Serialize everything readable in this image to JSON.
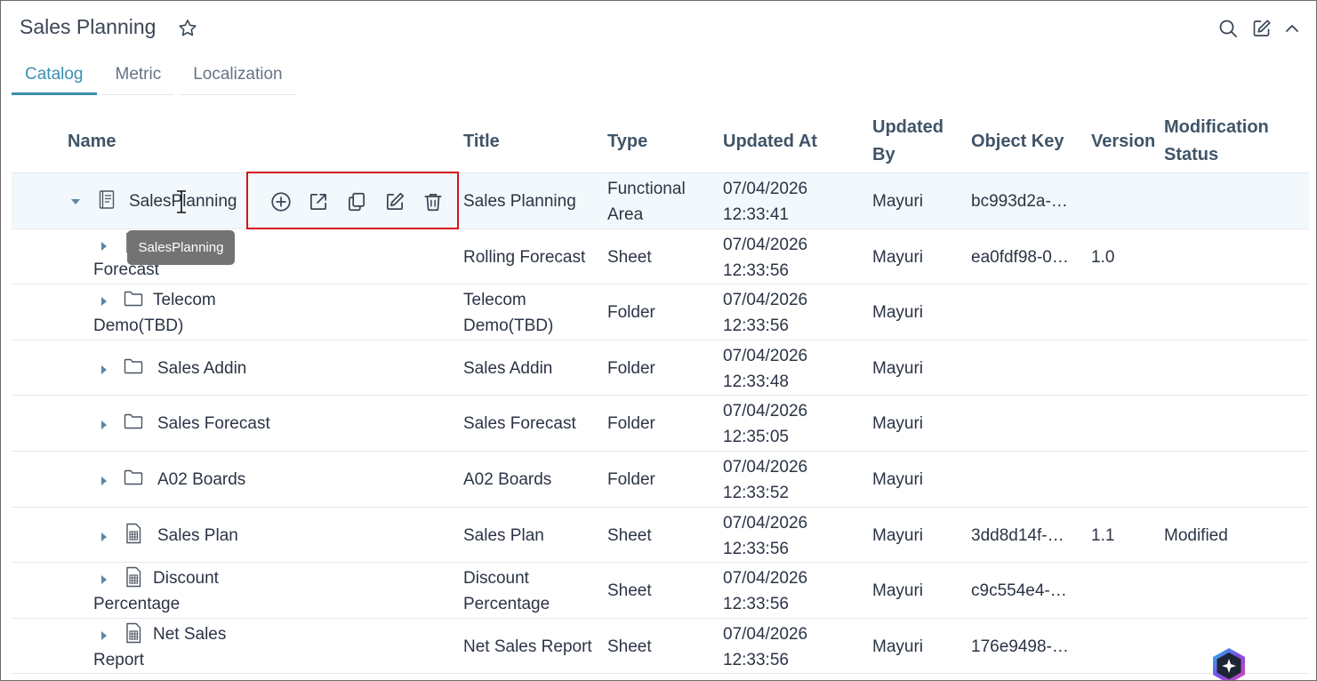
{
  "header": {
    "title": "Sales Planning",
    "icons": [
      "star-icon",
      "search-icon",
      "edit-icon",
      "chevron-up-icon"
    ]
  },
  "tabs": [
    {
      "label": "Catalog",
      "active": true
    },
    {
      "label": "Metric",
      "active": false
    },
    {
      "label": "Localization",
      "active": false
    }
  ],
  "columns": {
    "name": "Name",
    "title": "Title",
    "type": "Type",
    "updated_at": "Updated At",
    "updated_by_1": "Updated",
    "updated_by_2": "By",
    "object_key": "Object Key",
    "version": "Version",
    "mod_status_1": "Modification",
    "mod_status_2": "Status"
  },
  "rows": [
    {
      "name1": "SalesPlanning",
      "name2": "",
      "title1": "Sales Planning",
      "title2": "",
      "type1": "Functional",
      "type2": "Area",
      "date": "07/04/2026",
      "time": "12:33:41",
      "by": "Mayuri",
      "key": "bc993d2a-…",
      "version": "",
      "status": "",
      "icon": "functional-area-icon",
      "expanded": true
    },
    {
      "name1": "",
      "name2": "Forecast",
      "title1": "Rolling Forecast",
      "title2": "",
      "type1": "Sheet",
      "type2": "",
      "date": "07/04/2026",
      "time": "12:33:56",
      "by": "Mayuri",
      "key": "ea0fdf98-0…",
      "version": "1.0",
      "status": "",
      "icon": "sheet-icon"
    },
    {
      "name1": "Telecom",
      "name2": "Demo(TBD)",
      "title1": "Telecom",
      "title2": "Demo(TBD)",
      "type1": "Folder",
      "type2": "",
      "date": "07/04/2026",
      "time": "12:33:56",
      "by": "Mayuri",
      "key": "",
      "version": "",
      "status": "",
      "icon": "folder-icon"
    },
    {
      "name1": "Sales Addin",
      "name2": "",
      "title1": "Sales Addin",
      "title2": "",
      "type1": "Folder",
      "type2": "",
      "date": "07/04/2026",
      "time": "12:33:48",
      "by": "Mayuri",
      "key": "",
      "version": "",
      "status": "",
      "icon": "folder-icon"
    },
    {
      "name1": "Sales Forecast",
      "name2": "",
      "title1": "Sales Forecast",
      "title2": "",
      "type1": "Folder",
      "type2": "",
      "date": "07/04/2026",
      "time": "12:35:05",
      "by": "Mayuri",
      "key": "",
      "version": "",
      "status": "",
      "icon": "folder-icon"
    },
    {
      "name1": "A02 Boards",
      "name2": "",
      "title1": "A02 Boards",
      "title2": "",
      "type1": "Folder",
      "type2": "",
      "date": "07/04/2026",
      "time": "12:33:52",
      "by": "Mayuri",
      "key": "",
      "version": "",
      "status": "",
      "icon": "folder-icon"
    },
    {
      "name1": "Sales Plan",
      "name2": "",
      "title1": "Sales Plan",
      "title2": "",
      "type1": "Sheet",
      "type2": "",
      "date": "07/04/2026",
      "time": "12:33:56",
      "by": "Mayuri",
      "key": "3dd8d14f-…",
      "version": "1.1",
      "status": "Modified",
      "icon": "sheet-icon"
    },
    {
      "name1": "Discount",
      "name2": "Percentage",
      "title1": "Discount",
      "title2": "Percentage",
      "type1": "Sheet",
      "type2": "",
      "date": "07/04/2026",
      "time": "12:33:56",
      "by": "Mayuri",
      "key": "c9c554e4-…",
      "version": "",
      "status": "",
      "icon": "sheet-icon"
    },
    {
      "name1": "Net Sales",
      "name2": "Report",
      "title1": "Net Sales Report",
      "title2": "",
      "type1": "Sheet",
      "type2": "",
      "date": "07/04/2026",
      "time": "12:33:56",
      "by": "Mayuri",
      "key": "176e9498-…",
      "version": "",
      "status": "",
      "icon": "sheet-icon"
    }
  ],
  "row_actions": [
    "add-icon",
    "open-external-icon",
    "copy-icon",
    "edit-icon",
    "delete-icon"
  ],
  "tooltip": "SalesPlanning",
  "colors": {
    "accent": "#3c8fb0",
    "highlight": "#d6141a",
    "text": "#2b3445"
  }
}
